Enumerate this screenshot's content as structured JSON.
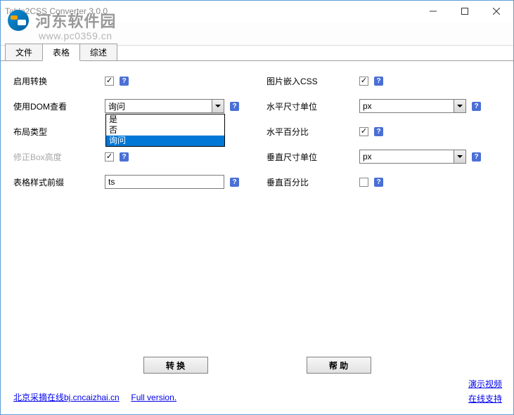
{
  "watermark": {
    "text": "河东软件园",
    "url": "www.pc0359.cn"
  },
  "window": {
    "title": "Table2CSS Converter 3.0.0"
  },
  "tabs": {
    "file": "文件",
    "table": "表格",
    "overview": "综述",
    "active": "table"
  },
  "left": {
    "enable_convert": {
      "label": "启用转换",
      "checked": true
    },
    "use_dom_view": {
      "label": "使用DOM查看",
      "value": "询问",
      "options": [
        "是",
        "否",
        "询问"
      ],
      "selected_index": 2
    },
    "layout_type": {
      "label": "布局类型"
    },
    "fix_box_height": {
      "label": "修正Box高度",
      "checked": true,
      "disabled": true
    },
    "table_style_prefix": {
      "label": "表格样式前缀",
      "value": "ts"
    }
  },
  "right": {
    "img_embed_css": {
      "label": "图片嵌入CSS",
      "checked": true
    },
    "h_size_unit": {
      "label": "水平尺寸单位",
      "value": "px"
    },
    "h_percent": {
      "label": "水平百分比",
      "checked": true
    },
    "v_size_unit": {
      "label": "垂直尺寸单位",
      "value": "px"
    },
    "v_percent": {
      "label": "垂直百分比",
      "checked": false
    }
  },
  "footer": {
    "convert_btn": "转 换",
    "help_btn": "帮 助",
    "left_link1": "北京采摘在线bj.cncaizhai.cn",
    "left_link2": "Full version.",
    "demo_video": "演示视频",
    "online_support": "在线支持"
  },
  "help_glyph": "?"
}
